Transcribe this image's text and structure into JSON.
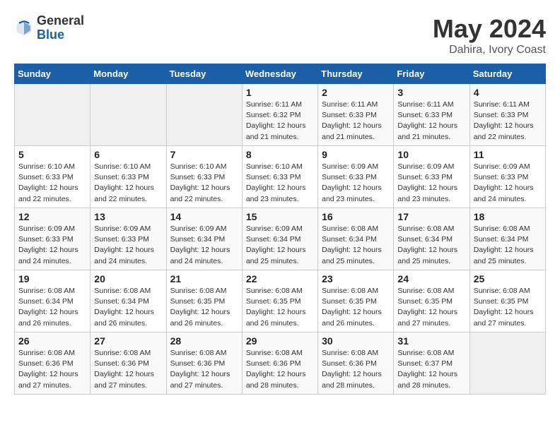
{
  "header": {
    "logo_general": "General",
    "logo_blue": "Blue",
    "title": "May 2024",
    "location": "Dahira, Ivory Coast"
  },
  "weekdays": [
    "Sunday",
    "Monday",
    "Tuesday",
    "Wednesday",
    "Thursday",
    "Friday",
    "Saturday"
  ],
  "weeks": [
    [
      {
        "day": "",
        "info": ""
      },
      {
        "day": "",
        "info": ""
      },
      {
        "day": "",
        "info": ""
      },
      {
        "day": "1",
        "info": "Sunrise: 6:11 AM\nSunset: 6:32 PM\nDaylight: 12 hours\nand 21 minutes."
      },
      {
        "day": "2",
        "info": "Sunrise: 6:11 AM\nSunset: 6:33 PM\nDaylight: 12 hours\nand 21 minutes."
      },
      {
        "day": "3",
        "info": "Sunrise: 6:11 AM\nSunset: 6:33 PM\nDaylight: 12 hours\nand 21 minutes."
      },
      {
        "day": "4",
        "info": "Sunrise: 6:11 AM\nSunset: 6:33 PM\nDaylight: 12 hours\nand 22 minutes."
      }
    ],
    [
      {
        "day": "5",
        "info": "Sunrise: 6:10 AM\nSunset: 6:33 PM\nDaylight: 12 hours\nand 22 minutes."
      },
      {
        "day": "6",
        "info": "Sunrise: 6:10 AM\nSunset: 6:33 PM\nDaylight: 12 hours\nand 22 minutes."
      },
      {
        "day": "7",
        "info": "Sunrise: 6:10 AM\nSunset: 6:33 PM\nDaylight: 12 hours\nand 22 minutes."
      },
      {
        "day": "8",
        "info": "Sunrise: 6:10 AM\nSunset: 6:33 PM\nDaylight: 12 hours\nand 23 minutes."
      },
      {
        "day": "9",
        "info": "Sunrise: 6:09 AM\nSunset: 6:33 PM\nDaylight: 12 hours\nand 23 minutes."
      },
      {
        "day": "10",
        "info": "Sunrise: 6:09 AM\nSunset: 6:33 PM\nDaylight: 12 hours\nand 23 minutes."
      },
      {
        "day": "11",
        "info": "Sunrise: 6:09 AM\nSunset: 6:33 PM\nDaylight: 12 hours\nand 24 minutes."
      }
    ],
    [
      {
        "day": "12",
        "info": "Sunrise: 6:09 AM\nSunset: 6:33 PM\nDaylight: 12 hours\nand 24 minutes."
      },
      {
        "day": "13",
        "info": "Sunrise: 6:09 AM\nSunset: 6:33 PM\nDaylight: 12 hours\nand 24 minutes."
      },
      {
        "day": "14",
        "info": "Sunrise: 6:09 AM\nSunset: 6:34 PM\nDaylight: 12 hours\nand 24 minutes."
      },
      {
        "day": "15",
        "info": "Sunrise: 6:09 AM\nSunset: 6:34 PM\nDaylight: 12 hours\nand 25 minutes."
      },
      {
        "day": "16",
        "info": "Sunrise: 6:08 AM\nSunset: 6:34 PM\nDaylight: 12 hours\nand 25 minutes."
      },
      {
        "day": "17",
        "info": "Sunrise: 6:08 AM\nSunset: 6:34 PM\nDaylight: 12 hours\nand 25 minutes."
      },
      {
        "day": "18",
        "info": "Sunrise: 6:08 AM\nSunset: 6:34 PM\nDaylight: 12 hours\nand 25 minutes."
      }
    ],
    [
      {
        "day": "19",
        "info": "Sunrise: 6:08 AM\nSunset: 6:34 PM\nDaylight: 12 hours\nand 26 minutes."
      },
      {
        "day": "20",
        "info": "Sunrise: 6:08 AM\nSunset: 6:34 PM\nDaylight: 12 hours\nand 26 minutes."
      },
      {
        "day": "21",
        "info": "Sunrise: 6:08 AM\nSunset: 6:35 PM\nDaylight: 12 hours\nand 26 minutes."
      },
      {
        "day": "22",
        "info": "Sunrise: 6:08 AM\nSunset: 6:35 PM\nDaylight: 12 hours\nand 26 minutes."
      },
      {
        "day": "23",
        "info": "Sunrise: 6:08 AM\nSunset: 6:35 PM\nDaylight: 12 hours\nand 26 minutes."
      },
      {
        "day": "24",
        "info": "Sunrise: 6:08 AM\nSunset: 6:35 PM\nDaylight: 12 hours\nand 27 minutes."
      },
      {
        "day": "25",
        "info": "Sunrise: 6:08 AM\nSunset: 6:35 PM\nDaylight: 12 hours\nand 27 minutes."
      }
    ],
    [
      {
        "day": "26",
        "info": "Sunrise: 6:08 AM\nSunset: 6:36 PM\nDaylight: 12 hours\nand 27 minutes."
      },
      {
        "day": "27",
        "info": "Sunrise: 6:08 AM\nSunset: 6:36 PM\nDaylight: 12 hours\nand 27 minutes."
      },
      {
        "day": "28",
        "info": "Sunrise: 6:08 AM\nSunset: 6:36 PM\nDaylight: 12 hours\nand 27 minutes."
      },
      {
        "day": "29",
        "info": "Sunrise: 6:08 AM\nSunset: 6:36 PM\nDaylight: 12 hours\nand 28 minutes."
      },
      {
        "day": "30",
        "info": "Sunrise: 6:08 AM\nSunset: 6:36 PM\nDaylight: 12 hours\nand 28 minutes."
      },
      {
        "day": "31",
        "info": "Sunrise: 6:08 AM\nSunset: 6:37 PM\nDaylight: 12 hours\nand 28 minutes."
      },
      {
        "day": "",
        "info": ""
      }
    ]
  ]
}
